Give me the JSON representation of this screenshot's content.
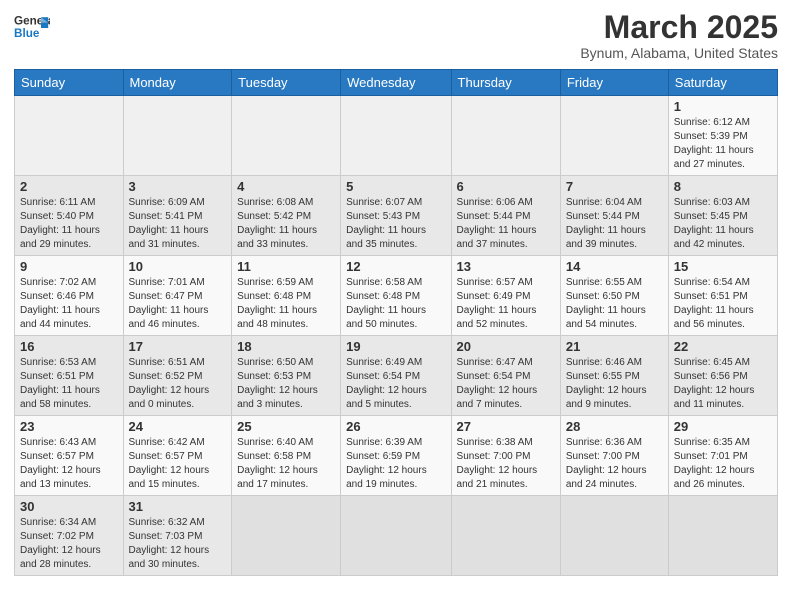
{
  "header": {
    "logo_general": "General",
    "logo_blue": "Blue",
    "month": "March 2025",
    "location": "Bynum, Alabama, United States"
  },
  "days_of_week": [
    "Sunday",
    "Monday",
    "Tuesday",
    "Wednesday",
    "Thursday",
    "Friday",
    "Saturday"
  ],
  "weeks": [
    [
      {
        "day": "",
        "info": ""
      },
      {
        "day": "",
        "info": ""
      },
      {
        "day": "",
        "info": ""
      },
      {
        "day": "",
        "info": ""
      },
      {
        "day": "",
        "info": ""
      },
      {
        "day": "",
        "info": ""
      },
      {
        "day": "1",
        "info": "Sunrise: 6:12 AM\nSunset: 5:39 PM\nDaylight: 11 hours\nand 27 minutes."
      }
    ],
    [
      {
        "day": "2",
        "info": "Sunrise: 6:11 AM\nSunset: 5:40 PM\nDaylight: 11 hours\nand 29 minutes."
      },
      {
        "day": "3",
        "info": "Sunrise: 6:09 AM\nSunset: 5:41 PM\nDaylight: 11 hours\nand 31 minutes."
      },
      {
        "day": "4",
        "info": "Sunrise: 6:08 AM\nSunset: 5:42 PM\nDaylight: 11 hours\nand 33 minutes."
      },
      {
        "day": "5",
        "info": "Sunrise: 6:07 AM\nSunset: 5:43 PM\nDaylight: 11 hours\nand 35 minutes."
      },
      {
        "day": "6",
        "info": "Sunrise: 6:06 AM\nSunset: 5:44 PM\nDaylight: 11 hours\nand 37 minutes."
      },
      {
        "day": "7",
        "info": "Sunrise: 6:04 AM\nSunset: 5:44 PM\nDaylight: 11 hours\nand 39 minutes."
      },
      {
        "day": "8",
        "info": "Sunrise: 6:03 AM\nSunset: 5:45 PM\nDaylight: 11 hours\nand 42 minutes."
      }
    ],
    [
      {
        "day": "9",
        "info": "Sunrise: 7:02 AM\nSunset: 6:46 PM\nDaylight: 11 hours\nand 44 minutes."
      },
      {
        "day": "10",
        "info": "Sunrise: 7:01 AM\nSunset: 6:47 PM\nDaylight: 11 hours\nand 46 minutes."
      },
      {
        "day": "11",
        "info": "Sunrise: 6:59 AM\nSunset: 6:48 PM\nDaylight: 11 hours\nand 48 minutes."
      },
      {
        "day": "12",
        "info": "Sunrise: 6:58 AM\nSunset: 6:48 PM\nDaylight: 11 hours\nand 50 minutes."
      },
      {
        "day": "13",
        "info": "Sunrise: 6:57 AM\nSunset: 6:49 PM\nDaylight: 11 hours\nand 52 minutes."
      },
      {
        "day": "14",
        "info": "Sunrise: 6:55 AM\nSunset: 6:50 PM\nDaylight: 11 hours\nand 54 minutes."
      },
      {
        "day": "15",
        "info": "Sunrise: 6:54 AM\nSunset: 6:51 PM\nDaylight: 11 hours\nand 56 minutes."
      }
    ],
    [
      {
        "day": "16",
        "info": "Sunrise: 6:53 AM\nSunset: 6:51 PM\nDaylight: 11 hours\nand 58 minutes."
      },
      {
        "day": "17",
        "info": "Sunrise: 6:51 AM\nSunset: 6:52 PM\nDaylight: 12 hours\nand 0 minutes."
      },
      {
        "day": "18",
        "info": "Sunrise: 6:50 AM\nSunset: 6:53 PM\nDaylight: 12 hours\nand 3 minutes."
      },
      {
        "day": "19",
        "info": "Sunrise: 6:49 AM\nSunset: 6:54 PM\nDaylight: 12 hours\nand 5 minutes."
      },
      {
        "day": "20",
        "info": "Sunrise: 6:47 AM\nSunset: 6:54 PM\nDaylight: 12 hours\nand 7 minutes."
      },
      {
        "day": "21",
        "info": "Sunrise: 6:46 AM\nSunset: 6:55 PM\nDaylight: 12 hours\nand 9 minutes."
      },
      {
        "day": "22",
        "info": "Sunrise: 6:45 AM\nSunset: 6:56 PM\nDaylight: 12 hours\nand 11 minutes."
      }
    ],
    [
      {
        "day": "23",
        "info": "Sunrise: 6:43 AM\nSunset: 6:57 PM\nDaylight: 12 hours\nand 13 minutes."
      },
      {
        "day": "24",
        "info": "Sunrise: 6:42 AM\nSunset: 6:57 PM\nDaylight: 12 hours\nand 15 minutes."
      },
      {
        "day": "25",
        "info": "Sunrise: 6:40 AM\nSunset: 6:58 PM\nDaylight: 12 hours\nand 17 minutes."
      },
      {
        "day": "26",
        "info": "Sunrise: 6:39 AM\nSunset: 6:59 PM\nDaylight: 12 hours\nand 19 minutes."
      },
      {
        "day": "27",
        "info": "Sunrise: 6:38 AM\nSunset: 7:00 PM\nDaylight: 12 hours\nand 21 minutes."
      },
      {
        "day": "28",
        "info": "Sunrise: 6:36 AM\nSunset: 7:00 PM\nDaylight: 12 hours\nand 24 minutes."
      },
      {
        "day": "29",
        "info": "Sunrise: 6:35 AM\nSunset: 7:01 PM\nDaylight: 12 hours\nand 26 minutes."
      }
    ],
    [
      {
        "day": "30",
        "info": "Sunrise: 6:34 AM\nSunset: 7:02 PM\nDaylight: 12 hours\nand 28 minutes."
      },
      {
        "day": "31",
        "info": "Sunrise: 6:32 AM\nSunset: 7:03 PM\nDaylight: 12 hours\nand 30 minutes."
      },
      {
        "day": "",
        "info": ""
      },
      {
        "day": "",
        "info": ""
      },
      {
        "day": "",
        "info": ""
      },
      {
        "day": "",
        "info": ""
      },
      {
        "day": "",
        "info": ""
      }
    ]
  ]
}
